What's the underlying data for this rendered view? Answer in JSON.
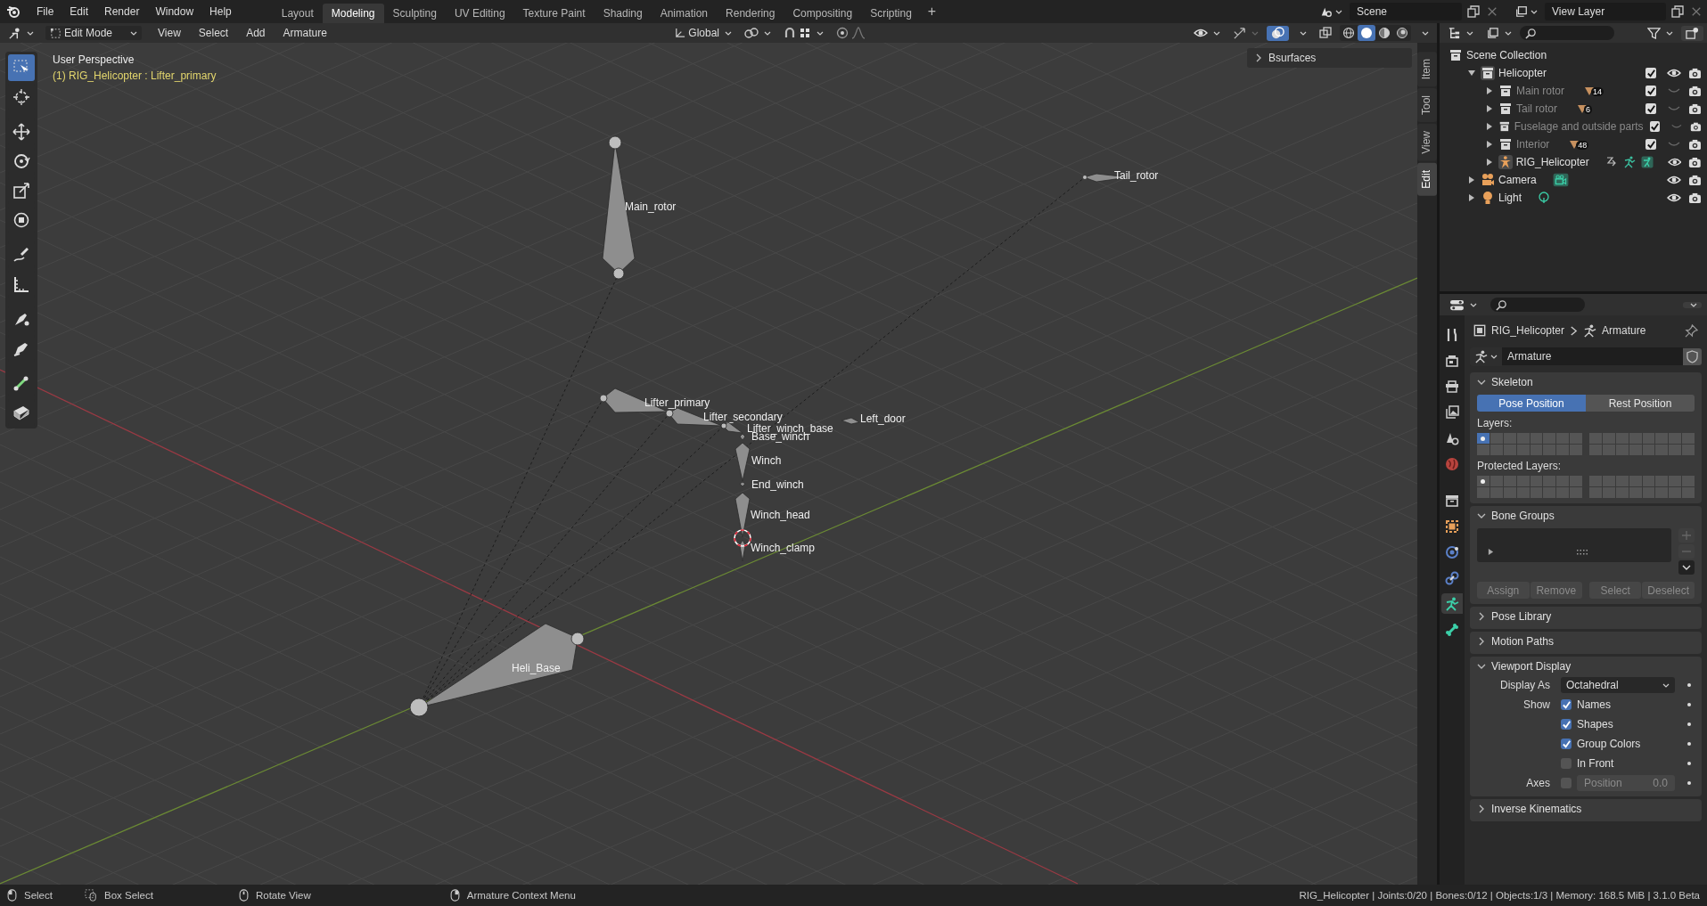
{
  "menubar": {
    "menus": [
      "File",
      "Edit",
      "Render",
      "Window",
      "Help"
    ],
    "workspaces": [
      {
        "label": "Layout",
        "selected": false
      },
      {
        "label": "Modeling",
        "selected": true
      },
      {
        "label": "Sculpting",
        "selected": false
      },
      {
        "label": "UV Editing",
        "selected": false
      },
      {
        "label": "Texture Paint",
        "selected": false
      },
      {
        "label": "Shading",
        "selected": false
      },
      {
        "label": "Animation",
        "selected": false
      },
      {
        "label": "Rendering",
        "selected": false
      },
      {
        "label": "Compositing",
        "selected": false
      },
      {
        "label": "Scripting",
        "selected": false
      }
    ],
    "add_tab": "+",
    "scene": "Scene",
    "view_layer": "View Layer"
  },
  "viewport": {
    "header": {
      "mode": "Edit Mode",
      "menus": [
        "View",
        "Select",
        "Add",
        "Armature"
      ],
      "orientation": "Global",
      "shading": [
        {
          "kind": "wireframe",
          "selected": false
        },
        {
          "kind": "solid",
          "selected": true
        },
        {
          "kind": "material",
          "selected": false
        },
        {
          "kind": "rendered",
          "selected": false
        }
      ]
    },
    "toolbar": [
      {
        "kind": "select",
        "selected": true
      },
      {
        "kind": "cursor",
        "selected": false
      },
      {
        "kind": "move",
        "selected": false
      },
      {
        "kind": "rotate",
        "selected": false
      },
      {
        "kind": "scale",
        "selected": false
      },
      {
        "kind": "transform",
        "selected": false
      },
      {
        "kind": "annotate",
        "selected": false
      },
      {
        "kind": "measure",
        "selected": false
      },
      {
        "kind": "roll",
        "selected": false
      },
      {
        "kind": "extrude",
        "selected": false
      },
      {
        "kind": "pen",
        "selected": false
      },
      {
        "kind": "envelope",
        "selected": false
      }
    ],
    "view_name": "User Perspective",
    "object_info": "(1) RIG_Helicopter : Lifter_primary",
    "side_panel": {
      "title": "Bsurfaces",
      "expanded": false
    },
    "side_tabs": [
      {
        "label": "Item",
        "selected": false
      },
      {
        "label": "Tool",
        "selected": false
      },
      {
        "label": "View",
        "selected": false
      },
      {
        "label": "Edit",
        "selected": true
      }
    ],
    "bones": [
      "Main_rotor",
      "Tail_rotor",
      "Lifter_primary",
      "Lifter_secondary",
      "Lifter_winch_base",
      "Base_winch",
      "Left_door",
      "Winch",
      "End_winch",
      "Winch_head",
      "Winch_clamp",
      "Heli_Base"
    ]
  },
  "outliner": {
    "tree": [
      {
        "label": "Scene Collection",
        "kind": "scene",
        "children": [
          {
            "label": "Helicopter",
            "kind": "collection",
            "expanded": true,
            "checked": true,
            "visible": true,
            "children": [
              {
                "label": "Main rotor",
                "kind": "collection",
                "expanded": false,
                "checked": true,
                "visible": false,
                "badge": "14"
              },
              {
                "label": "Tail rotor",
                "kind": "collection",
                "expanded": false,
                "checked": true,
                "visible": false,
                "badge": "6"
              },
              {
                "label": "Fuselage and outside parts",
                "kind": "collection",
                "expanded": false,
                "checked": true,
                "visible": false
              },
              {
                "label": "Interior",
                "kind": "collection",
                "expanded": false,
                "checked": true,
                "visible": false,
                "badge": "48"
              },
              {
                "label": "RIG_Helicopter",
                "kind": "armature",
                "expanded": false,
                "visible": true
              }
            ]
          },
          {
            "label": "Camera",
            "kind": "camera",
            "expanded": false,
            "visible": true
          },
          {
            "label": "Light",
            "kind": "light",
            "expanded": false,
            "visible": true
          }
        ]
      }
    ]
  },
  "properties": {
    "tabs": [
      {
        "kind": "tool",
        "selected": false
      },
      {
        "kind": "render",
        "selected": false
      },
      {
        "kind": "output",
        "selected": false
      },
      {
        "kind": "view_layer",
        "selected": false
      },
      {
        "kind": "scene",
        "selected": false
      },
      {
        "kind": "world",
        "selected": false
      },
      {
        "kind": "collection",
        "selected": false
      },
      {
        "kind": "object",
        "selected": false
      },
      {
        "kind": "physics",
        "selected": false
      },
      {
        "kind": "constraints",
        "selected": false
      },
      {
        "kind": "data",
        "selected": true
      },
      {
        "kind": "bone",
        "selected": false
      }
    ],
    "breadcrumb": [
      "RIG_Helicopter",
      "Armature"
    ],
    "datablock": "Armature",
    "skeleton": {
      "title": "Skeleton",
      "expanded": true,
      "positions": [
        {
          "label": "Pose Position",
          "selected": true
        },
        {
          "label": "Rest Position",
          "selected": false
        }
      ],
      "layers_label": "Layers:",
      "layers": [
        {
          "selected": true,
          "used": true
        },
        {
          "selected": false,
          "used": false
        },
        {
          "selected": false,
          "used": false
        },
        {
          "selected": false,
          "used": false
        },
        {
          "selected": false,
          "used": false
        },
        {
          "selected": false,
          "used": false
        },
        {
          "selected": false,
          "used": false
        },
        {
          "selected": false,
          "used": false
        },
        {
          "selected": false,
          "used": false
        },
        {
          "selected": false,
          "used": false
        },
        {
          "selected": false,
          "used": false
        },
        {
          "selected": false,
          "used": false
        },
        {
          "selected": false,
          "used": false
        },
        {
          "selected": false,
          "used": false
        },
        {
          "selected": false,
          "used": false
        },
        {
          "selected": false,
          "used": false
        },
        {
          "selected": false,
          "used": false
        },
        {
          "selected": false,
          "used": false
        },
        {
          "selected": false,
          "used": false
        },
        {
          "selected": false,
          "used": false
        },
        {
          "selected": false,
          "used": false
        },
        {
          "selected": false,
          "used": false
        },
        {
          "selected": false,
          "used": false
        },
        {
          "selected": false,
          "used": false
        },
        {
          "selected": false,
          "used": false
        },
        {
          "selected": false,
          "used": false
        },
        {
          "selected": false,
          "used": false
        },
        {
          "selected": false,
          "used": false
        },
        {
          "selected": false,
          "used": false
        },
        {
          "selected": false,
          "used": false
        },
        {
          "selected": false,
          "used": false
        },
        {
          "selected": false,
          "used": false
        }
      ],
      "protected_label": "Protected Layers:",
      "protected_layers": [
        {
          "selected": false,
          "used": true
        },
        {
          "selected": false,
          "used": false
        },
        {
          "selected": false,
          "used": false
        },
        {
          "selected": false,
          "used": false
        },
        {
          "selected": false,
          "used": false
        },
        {
          "selected": false,
          "used": false
        },
        {
          "selected": false,
          "used": false
        },
        {
          "selected": false,
          "used": false
        },
        {
          "selected": false,
          "used": false
        },
        {
          "selected": false,
          "used": false
        },
        {
          "selected": false,
          "used": false
        },
        {
          "selected": false,
          "used": false
        },
        {
          "selected": false,
          "used": false
        },
        {
          "selected": false,
          "used": false
        },
        {
          "selected": false,
          "used": false
        },
        {
          "selected": false,
          "used": false
        },
        {
          "selected": false,
          "used": false
        },
        {
          "selected": false,
          "used": false
        },
        {
          "selected": false,
          "used": false
        },
        {
          "selected": false,
          "used": false
        },
        {
          "selected": false,
          "used": false
        },
        {
          "selected": false,
          "used": false
        },
        {
          "selected": false,
          "used": false
        },
        {
          "selected": false,
          "used": false
        },
        {
          "selected": false,
          "used": false
        },
        {
          "selected": false,
          "used": false
        },
        {
          "selected": false,
          "used": false
        },
        {
          "selected": false,
          "used": false
        },
        {
          "selected": false,
          "used": false
        },
        {
          "selected": false,
          "used": false
        },
        {
          "selected": false,
          "used": false
        },
        {
          "selected": false,
          "used": false
        }
      ]
    },
    "bone_groups": {
      "title": "Bone Groups",
      "expanded": true,
      "buttons": [
        {
          "label": "Assign",
          "disabled": true
        },
        {
          "label": "Remove",
          "disabled": true
        },
        {
          "label": "Select",
          "disabled": true
        },
        {
          "label": "Deselect",
          "disabled": true
        }
      ]
    },
    "collapsed_panels": [
      {
        "title": "Pose Library",
        "expanded": false
      },
      {
        "title": "Motion Paths",
        "expanded": false
      }
    ],
    "viewport_display": {
      "title": "Viewport Display",
      "expanded": true,
      "display_as_label": "Display As",
      "display_as": "Octahedral",
      "show_label": "Show",
      "options": [
        {
          "label": "Names",
          "checked": true
        },
        {
          "label": "Shapes",
          "checked": true
        },
        {
          "label": "Group Colors",
          "checked": true
        },
        {
          "label": "In Front",
          "checked": false
        }
      ],
      "axes_label": "Axes",
      "axes": false,
      "position_label": "Position",
      "position_value": "0.0"
    },
    "last_panel": {
      "title": "Inverse Kinematics",
      "expanded": false
    }
  },
  "status_bar": {
    "hints": [
      {
        "kind": "left",
        "label": "Select"
      },
      {
        "kind": "box",
        "label": "Box Select"
      },
      {
        "kind": "middle",
        "label": "Rotate View"
      },
      {
        "kind": "right",
        "label": "Armature Context Menu"
      }
    ],
    "stats": "RIG_Helicopter | Joints:0/20 | Bones:0/12 | Objects:1/3 | Memory: 168.5 MiB | 3.1.0 Beta"
  }
}
